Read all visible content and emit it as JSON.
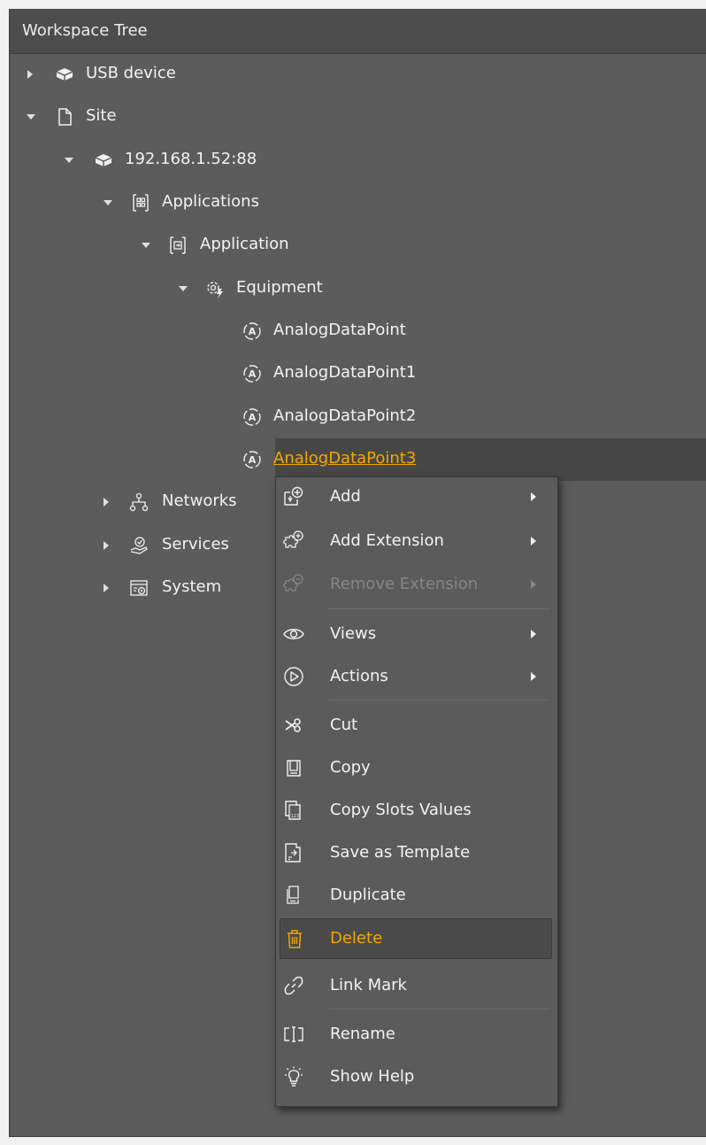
{
  "panel": {
    "title": "Workspace Tree"
  },
  "tree": [
    {
      "label": "USB device",
      "icon": "usb-device-icon"
    },
    {
      "label": "Site",
      "icon": "page-icon"
    },
    {
      "label": "192.168.1.52:88",
      "icon": "device-icon"
    },
    {
      "label": "Applications",
      "icon": "applications-icon"
    },
    {
      "label": "Application",
      "icon": "application-icon"
    },
    {
      "label": "Equipment",
      "icon": "equipment-icon"
    },
    {
      "label": "AnalogDataPoint",
      "icon": "analog-datapoint-icon"
    },
    {
      "label": "AnalogDataPoint1",
      "icon": "analog-datapoint-icon"
    },
    {
      "label": "AnalogDataPoint2",
      "icon": "analog-datapoint-icon"
    },
    {
      "label": "AnalogDataPoint3",
      "icon": "analog-datapoint-icon",
      "selected": true
    },
    {
      "label": "Networks",
      "icon": "networks-icon"
    },
    {
      "label": "Services",
      "icon": "services-icon"
    },
    {
      "label": "System",
      "icon": "system-icon"
    }
  ],
  "context_menu": {
    "items": [
      {
        "label": "Add",
        "icon": "add-icon",
        "submenu": true
      },
      {
        "label": "Add Extension",
        "icon": "add-extension-icon",
        "submenu": true
      },
      {
        "label": "Remove Extension",
        "icon": "remove-extension-icon",
        "submenu": true,
        "disabled": true
      },
      {
        "label": "Views",
        "icon": "eye-icon",
        "submenu": true
      },
      {
        "label": "Actions",
        "icon": "play-circle-icon",
        "submenu": true
      },
      {
        "label": "Cut",
        "icon": "scissors-icon"
      },
      {
        "label": "Copy",
        "icon": "copy-icon"
      },
      {
        "label": "Copy Slots Values",
        "icon": "copy-values-icon"
      },
      {
        "label": "Save as Template",
        "icon": "template-icon"
      },
      {
        "label": "Duplicate",
        "icon": "duplicate-icon"
      },
      {
        "label": "Delete",
        "icon": "trash-icon",
        "highlighted": true
      },
      {
        "label": "Link Mark",
        "icon": "link-icon"
      },
      {
        "label": "Rename",
        "icon": "rename-icon"
      },
      {
        "label": "Show Help",
        "icon": "lightbulb-icon"
      }
    ]
  },
  "colors": {
    "panel_bg": "#5c5c5c",
    "header_bg": "#4d4d4d",
    "accent": "#f2a700",
    "text": "#f2f2f2",
    "disabled": "#868686"
  }
}
